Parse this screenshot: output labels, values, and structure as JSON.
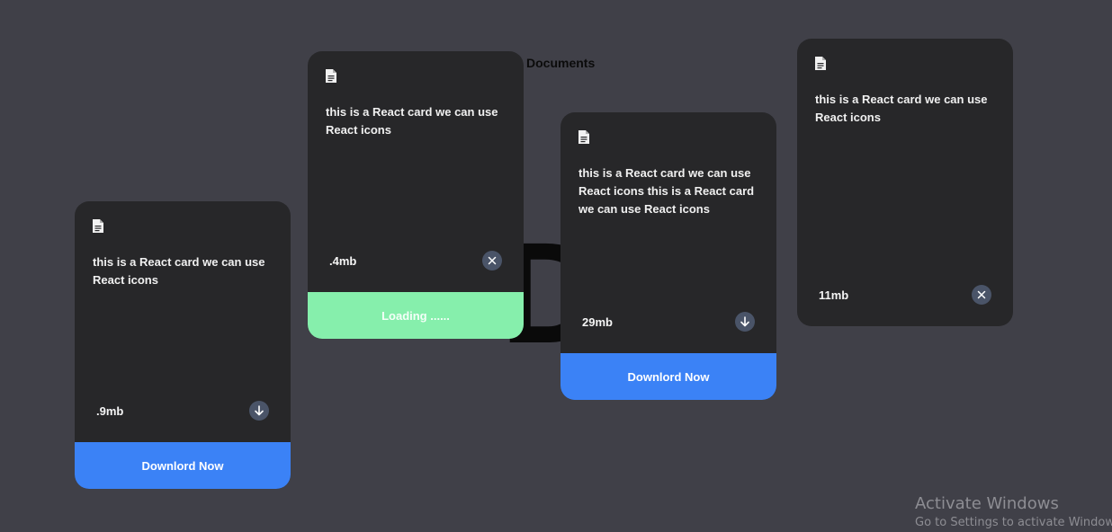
{
  "section": {
    "title": "Documents",
    "big_letter": "D"
  },
  "cards": [
    {
      "description": "this is a React card we can use React icons",
      "size": ".9mb",
      "action_icon": "arrow-down-icon",
      "footer": "Downlord Now"
    },
    {
      "description": "this is a React card we can use React icons",
      "size": ".4mb",
      "action_icon": "close-icon",
      "footer": "Loading ......"
    },
    {
      "description": "this is a React card we can use React icons this is a React card we can use React icons",
      "size": "29mb",
      "action_icon": "arrow-down-icon",
      "footer": "Downlord Now"
    },
    {
      "description": "this is a React card we can use React icons",
      "size": "11mb",
      "action_icon": "close-icon"
    }
  ],
  "watermark": {
    "title": "Activate Windows",
    "subtitle": "Go to Settings to activate Windows."
  },
  "colors": {
    "background": "#404048",
    "card": "#272729",
    "download": "#3b82f6",
    "loading": "#86efac",
    "icon_button": "#4a5468"
  }
}
